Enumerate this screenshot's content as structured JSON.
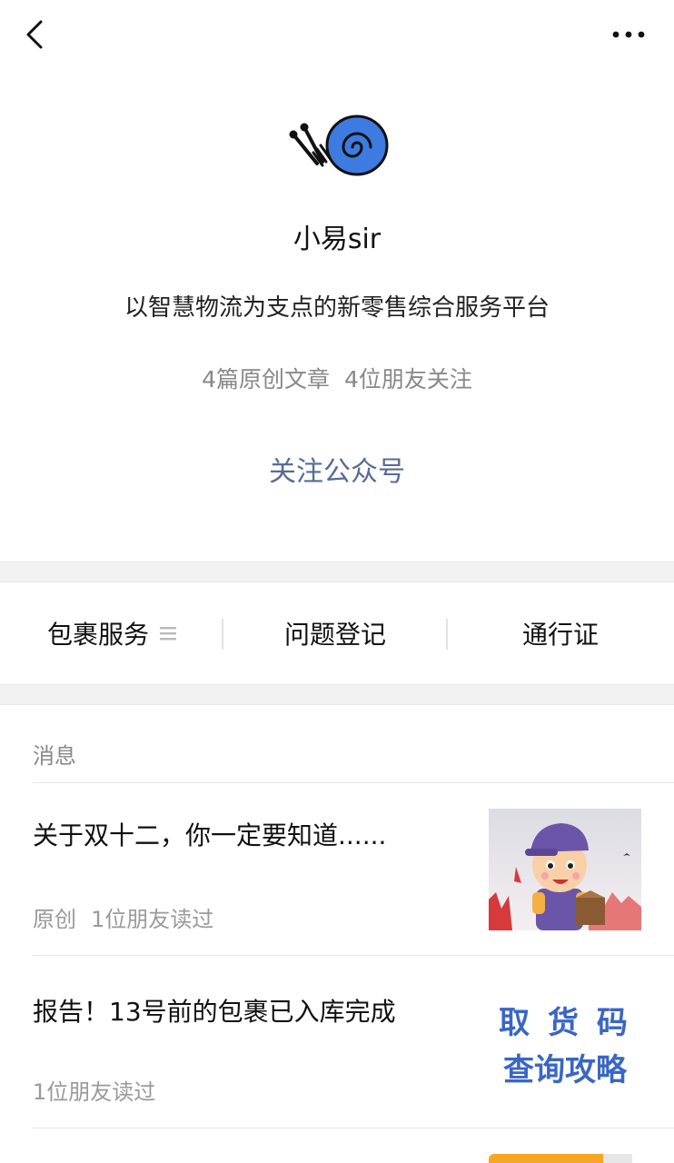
{
  "nav": {
    "back_icon": "chevron-left-icon",
    "more_icon": "more-dots-icon"
  },
  "profile": {
    "name": "小易sir",
    "description": "以智慧物流为支点的新零售综合服务平台",
    "stats": {
      "articles": "4篇原创文章",
      "friends": "4位朋友关注"
    },
    "follow_label": "关注公众号",
    "follow_color": "#576b95"
  },
  "menu": {
    "items": [
      {
        "label": "包裹服务",
        "icon": "menu-list-icon"
      },
      {
        "label": "问题登记"
      },
      {
        "label": "通行证"
      }
    ]
  },
  "messages": {
    "section_title": "消息",
    "articles": [
      {
        "title": "关于双十二，你一定要知道......",
        "tag": "原创",
        "reads": "1位朋友读过"
      },
      {
        "title": "报告！13号前的包裹已入库完成",
        "reads": "1位朋友读过",
        "thumb_text_1": "取 货 码",
        "thumb_text_2": "查询攻略"
      }
    ]
  }
}
